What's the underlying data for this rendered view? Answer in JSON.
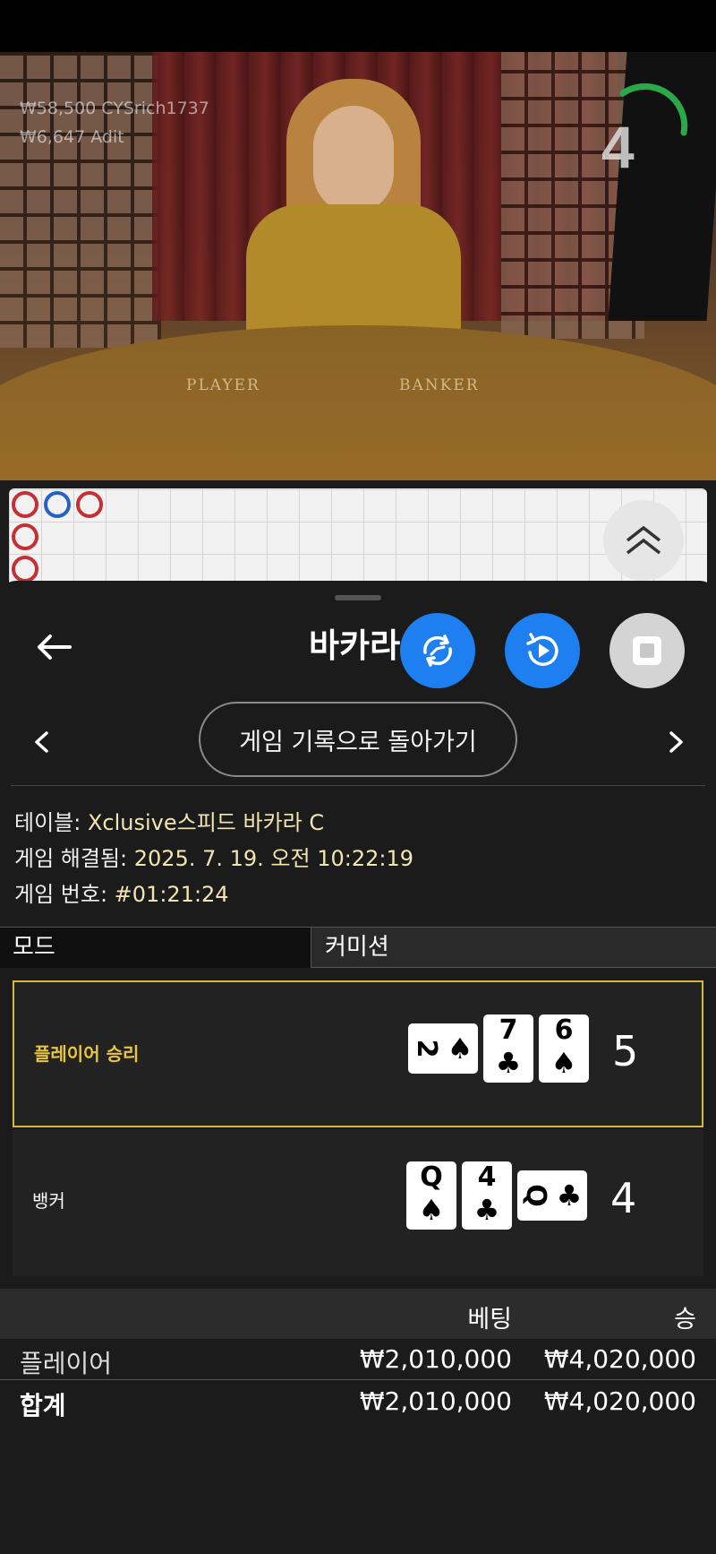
{
  "video": {
    "overlay_line_1": "₩58,500  CYSrich1737",
    "overlay_line_2": "₩6,647  Adit",
    "countdown": "4",
    "table_labels": {
      "player": "PLAYER",
      "banker": "BANKER"
    }
  },
  "sheet": {
    "title": "바카라",
    "back_icon": "arrow-left-icon",
    "history_button": "게임 기록으로 돌아가기",
    "info": {
      "table_label": "테이블: ",
      "table_value": "Xclusive스피드 바카라 C",
      "resolved_label": "게임 해결됨: ",
      "resolved_value": "2025. 7. 19. 오전 10:22:19",
      "round_label": "게임 번호: ",
      "round_value": "#01:21:24"
    },
    "tabs": {
      "mode": "모드",
      "commission": "커미션"
    }
  },
  "results": {
    "player": {
      "label": "플레이어 승리",
      "score": "5",
      "cards": [
        {
          "rank": "2",
          "suit": "♠",
          "sideways": true
        },
        {
          "rank": "7",
          "suit": "♣"
        },
        {
          "rank": "6",
          "suit": "♠"
        }
      ]
    },
    "banker": {
      "label": "뱅커",
      "score": "4",
      "cards": [
        {
          "rank": "Q",
          "suit": "♠"
        },
        {
          "rank": "4",
          "suit": "♣"
        },
        {
          "rank": "Q",
          "suit": "♣",
          "sideways": true
        }
      ]
    }
  },
  "bets": {
    "headers": {
      "bet": "베팅",
      "win": "승"
    },
    "rows": [
      {
        "name": "플레이어",
        "bet": "₩2,010,000",
        "win": "₩4,020,000"
      }
    ],
    "total": {
      "name": "합계",
      "bet": "₩2,010,000",
      "win": "₩4,020,000"
    }
  },
  "colors": {
    "accent_blue": "#1d7ff0",
    "win_gold": "#d6b93c",
    "roadmap_red": "#c43033",
    "roadmap_blue": "#2461c8"
  }
}
